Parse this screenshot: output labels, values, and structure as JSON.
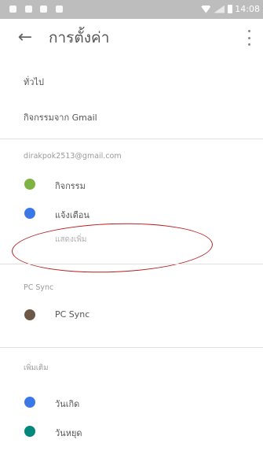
{
  "status_bar": {
    "time": "14:08"
  },
  "app_bar": {
    "title": "การตั้งค่า",
    "back_icon": "←"
  },
  "general": {
    "label": "ทั่วไป"
  },
  "gmail_events": {
    "label": "กิจกรรมจาก Gmail"
  },
  "account": {
    "email": "dirakpok2513@gmail.com",
    "items": [
      {
        "label": "กิจกรรม",
        "color": "#7cb342"
      },
      {
        "label": "แจ้งเตือน",
        "color": "#3b78e7"
      }
    ],
    "show_more": "แสดงเพิ่ม"
  },
  "pc_sync": {
    "header": "PC Sync",
    "items": [
      {
        "label": "PC Sync",
        "color": "#6d5847"
      }
    ]
  },
  "more_section": {
    "header": "เพิ่มเติม",
    "items": [
      {
        "label": "วันเกิด",
        "color": "#3b78e7"
      },
      {
        "label": "วันหยุด",
        "color": "#00897b"
      }
    ]
  },
  "annotation": {
    "color": "#b71c1c"
  }
}
